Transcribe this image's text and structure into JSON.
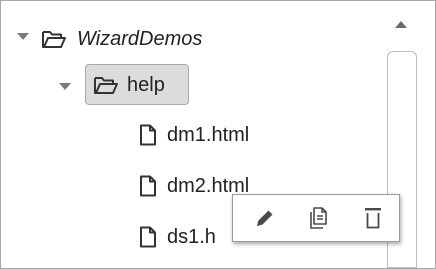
{
  "tree": {
    "root": {
      "label": "WizardDemos",
      "icon": "folder-open-icon",
      "expanded": true
    },
    "help": {
      "label": "help",
      "icon": "folder-open-icon",
      "expanded": true,
      "selected": true
    },
    "files": [
      {
        "label": "dm1.html",
        "icon": "file-icon"
      },
      {
        "label": "dm2.html",
        "icon": "file-icon"
      },
      {
        "label": "ds1.h",
        "icon": "file-icon"
      }
    ]
  },
  "actions": {
    "rename": "pencil-icon",
    "duplicate": "copy-icon",
    "delete": "trash-icon"
  },
  "colors": {
    "text": "#222222",
    "selected_bg": "#dcdcdc",
    "icon": "#555555",
    "border": "#a7a7a7"
  }
}
